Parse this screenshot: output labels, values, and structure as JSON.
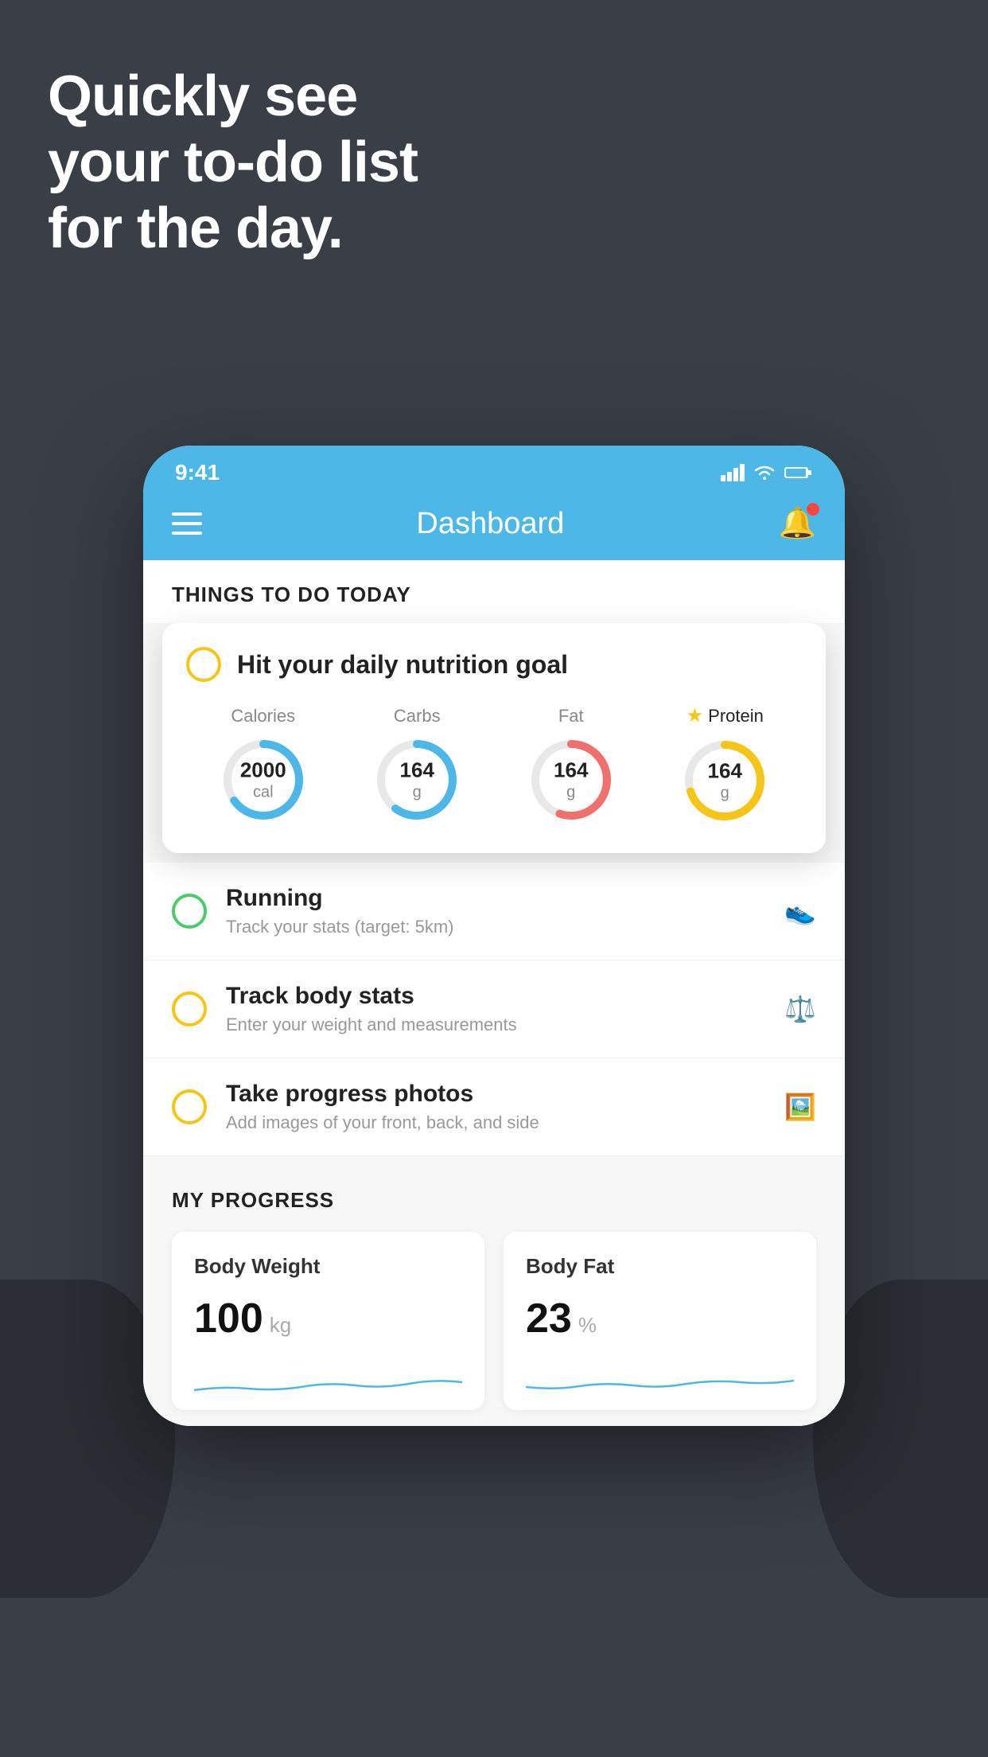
{
  "headline": {
    "line1": "Quickly see",
    "line2": "your to-do list",
    "line3": "for the day."
  },
  "status_bar": {
    "time": "9:41",
    "signal": "signal-icon",
    "wifi": "wifi-icon",
    "battery": "battery-icon"
  },
  "header": {
    "menu_icon": "menu-icon",
    "title": "Dashboard",
    "bell_icon": "bell-icon"
  },
  "section_todo": {
    "title": "THINGS TO DO TODAY"
  },
  "nutrition_card": {
    "title": "Hit your daily nutrition goal",
    "calories": {
      "label": "Calories",
      "value": "2000",
      "unit": "cal",
      "color": "#4db8e8",
      "percent": 65
    },
    "carbs": {
      "label": "Carbs",
      "value": "164",
      "unit": "g",
      "color": "#4db8e8",
      "percent": 60
    },
    "fat": {
      "label": "Fat",
      "value": "164",
      "unit": "g",
      "color": "#f07070",
      "percent": 55
    },
    "protein": {
      "label": "Protein",
      "value": "164",
      "unit": "g",
      "color": "#f5c518",
      "percent": 70,
      "starred": true
    }
  },
  "todo_items": [
    {
      "id": "running",
      "title": "Running",
      "subtitle": "Track your stats (target: 5km)",
      "circle_color": "green",
      "icon": "shoe-icon"
    },
    {
      "id": "body-stats",
      "title": "Track body stats",
      "subtitle": "Enter your weight and measurements",
      "circle_color": "yellow",
      "icon": "scale-icon"
    },
    {
      "id": "photos",
      "title": "Take progress photos",
      "subtitle": "Add images of your front, back, and side",
      "circle_color": "yellow",
      "icon": "photo-icon"
    }
  ],
  "progress_section": {
    "title": "MY PROGRESS",
    "body_weight": {
      "label": "Body Weight",
      "value": "100",
      "unit": "kg"
    },
    "body_fat": {
      "label": "Body Fat",
      "value": "23",
      "unit": "%"
    }
  }
}
